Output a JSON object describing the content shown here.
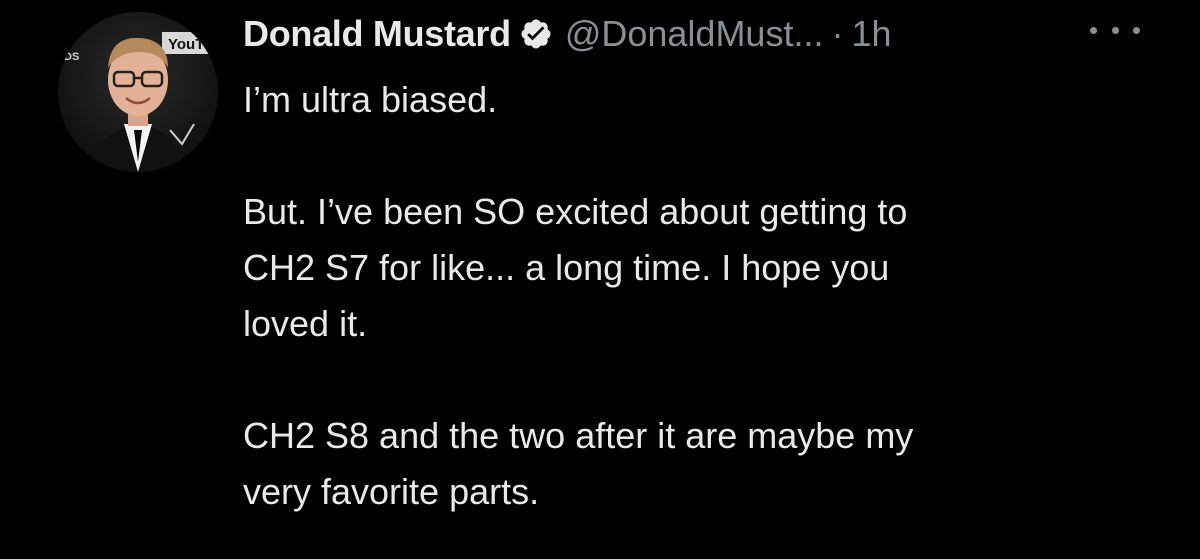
{
  "author": {
    "display_name": "Donald Mustard",
    "handle": "@DonaldMust...",
    "separator": "·",
    "time": "1h",
    "avatar_icon": "profile-photo",
    "verified_icon": "verified-badge-icon",
    "avatar_text": "YouTu"
  },
  "tweet": {
    "paragraphs": [
      "I’m ultra biased.",
      "But. I’ve been SO excited about getting to\nCH2 S7 for like... a long time. I hope you\nloved it.",
      "CH2 S8 and the two after it are maybe my\nvery favorite parts."
    ]
  },
  "actions": {
    "more_icon": "more-options-icon"
  },
  "colors": {
    "background": "#000000",
    "text": "#e7e9ea",
    "secondary": "#8b8f94"
  }
}
